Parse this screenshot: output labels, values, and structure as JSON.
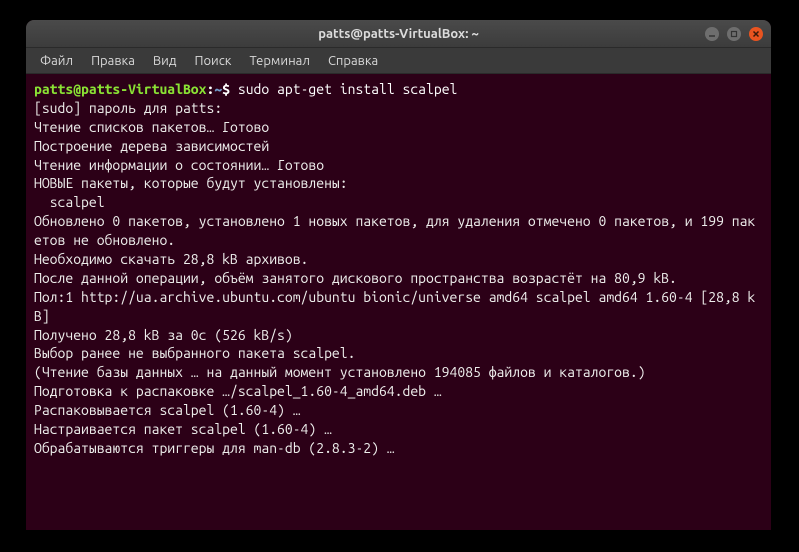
{
  "window": {
    "title": "patts@patts-VirtualBox: ~"
  },
  "menubar": {
    "items": [
      {
        "label": "Файл"
      },
      {
        "label": "Правка"
      },
      {
        "label": "Вид"
      },
      {
        "label": "Поиск"
      },
      {
        "label": "Терминал"
      },
      {
        "label": "Справка"
      }
    ]
  },
  "prompt": {
    "user_host": "patts@patts-VirtualBox",
    "colon": ":",
    "path": "~",
    "symbol": "$"
  },
  "command": "sudo apt-get install scalpel",
  "output": {
    "lines": [
      "[sudo] пароль для patts:",
      "Чтение списков пакетов… Готово",
      "Построение дерева зависимостей",
      "Чтение информации о состоянии… Готово",
      "НОВЫЕ пакеты, которые будут установлены:",
      "  scalpel",
      "Обновлено 0 пакетов, установлено 1 новых пакетов, для удаления отмечено 0 пакетов, и 199 пакетов не обновлено.",
      "Необходимо скачать 28,8 kB архивов.",
      "После данной операции, объём занятого дискового пространства возрастёт на 80,9 kB.",
      "Пол:1 http://ua.archive.ubuntu.com/ubuntu bionic/universe amd64 scalpel amd64 1.60-4 [28,8 kB]",
      "Получено 28,8 kB за 0с (526 kB/s)",
      "Выбор ранее не выбранного пакета scalpel.",
      "(Чтение базы данных … на данный момент установлено 194085 файлов и каталогов.)",
      "Подготовка к распаковке …/scalpel_1.60-4_amd64.deb …",
      "Распаковывается scalpel (1.60-4) …",
      "Настраивается пакет scalpel (1.60-4) …",
      "Обрабатываются триггеры для man-db (2.8.3-2) …"
    ]
  }
}
